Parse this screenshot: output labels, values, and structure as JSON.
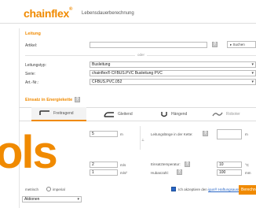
{
  "header": {
    "logo": "chainflex",
    "logo_mark": "®",
    "subtitle": "Lebensdauerberechnung"
  },
  "leitung": {
    "title": "Leitung",
    "artikel_label": "Artikel:",
    "artikel_value": "",
    "search_button": "Suchen",
    "oder_text": "oder",
    "leitungstyp_label": "Leitungstyp:",
    "leitungstyp_value": "Busleitung",
    "serie_label": "Serie:",
    "serie_value": "chainflex® CFBUS.PVC Busleitung PVC",
    "artnr_label": "Art.-Nr.:",
    "artnr_value": "CFBUS.PVC.052",
    "help": "?"
  },
  "einsatz": {
    "title": "Einsatz in Energiekette",
    "help": "?"
  },
  "tabs": [
    {
      "label": "Freitragend",
      "icon": "freitragend-icon",
      "active": true
    },
    {
      "label": "Gleitend",
      "icon": "gleitend-icon",
      "active": false
    },
    {
      "label": "Hängend",
      "icon": "haengend-icon",
      "active": false
    },
    {
      "label": "Roboter",
      "icon": "roboter-icon",
      "active": false
    }
  ],
  "params": {
    "field1_value": "5",
    "field1_unit": "m",
    "leitungslaenge_label": "Leitungslänge in der Kette:",
    "leitungslaenge_value": "",
    "leitungslaenge_unit": "m",
    "speed_value": "2",
    "speed_unit": "m/s",
    "accel_value": "1",
    "accel_unit": "m/s²",
    "temp_label": "Einsatztemperatur:",
    "temp_value": "10",
    "temp_unit": "°C",
    "hub_label": "Hubanzahl:",
    "hub_value": "100",
    "hub_unit": "mm"
  },
  "units": {
    "metric_label": "metrisch",
    "imperial_label": "imperial"
  },
  "footer": {
    "agree_prefix": "Ich akzeptiere den ",
    "agree_link": "igus® Haftungsausschluss",
    "action_select": "Aktionen",
    "submit": "Berechnen"
  },
  "overlay": {
    "text": "ols"
  },
  "colors": {
    "accent": "#f08a00",
    "link": "#2a67c6"
  }
}
